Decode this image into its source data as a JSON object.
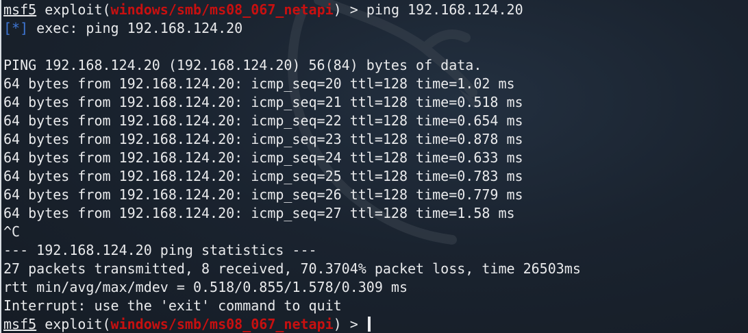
{
  "prompt": {
    "name": "msf5",
    "context_prefix": " exploit(",
    "module": "windows/smb/ms08_067_netapi",
    "context_suffix": ") > "
  },
  "command": "ping 192.168.124.20",
  "exec": {
    "marker": "[*]",
    "text": " exec: ping 192.168.124.20"
  },
  "output": {
    "header": "PING 192.168.124.20 (192.168.124.20) 56(84) bytes of data.",
    "replies": [
      "64 bytes from 192.168.124.20: icmp_seq=20 ttl=128 time=1.02 ms",
      "64 bytes from 192.168.124.20: icmp_seq=21 ttl=128 time=0.518 ms",
      "64 bytes from 192.168.124.20: icmp_seq=22 ttl=128 time=0.654 ms",
      "64 bytes from 192.168.124.20: icmp_seq=23 ttl=128 time=0.878 ms",
      "64 bytes from 192.168.124.20: icmp_seq=24 ttl=128 time=0.633 ms",
      "64 bytes from 192.168.124.20: icmp_seq=25 ttl=128 time=0.783 ms",
      "64 bytes from 192.168.124.20: icmp_seq=26 ttl=128 time=0.779 ms",
      "64 bytes from 192.168.124.20: icmp_seq=27 ttl=128 time=1.58 ms"
    ],
    "interrupt": "^C",
    "stats_header": "--- 192.168.124.20 ping statistics ---",
    "stats_packets": "27 packets transmitted, 8 received, 70.3704% packet loss, time 26503ms",
    "stats_rtt": "rtt min/avg/max/mdev = 0.518/0.855/1.578/0.309 ms",
    "notice": "Interrupt: use the 'exit' command to quit"
  },
  "colors": {
    "background": "#18202a",
    "foreground": "#e9eaec",
    "module_red": "#c81010",
    "info_blue": "#3f77d6"
  },
  "icons": {
    "background": "kali-dragon-logo-icon"
  }
}
